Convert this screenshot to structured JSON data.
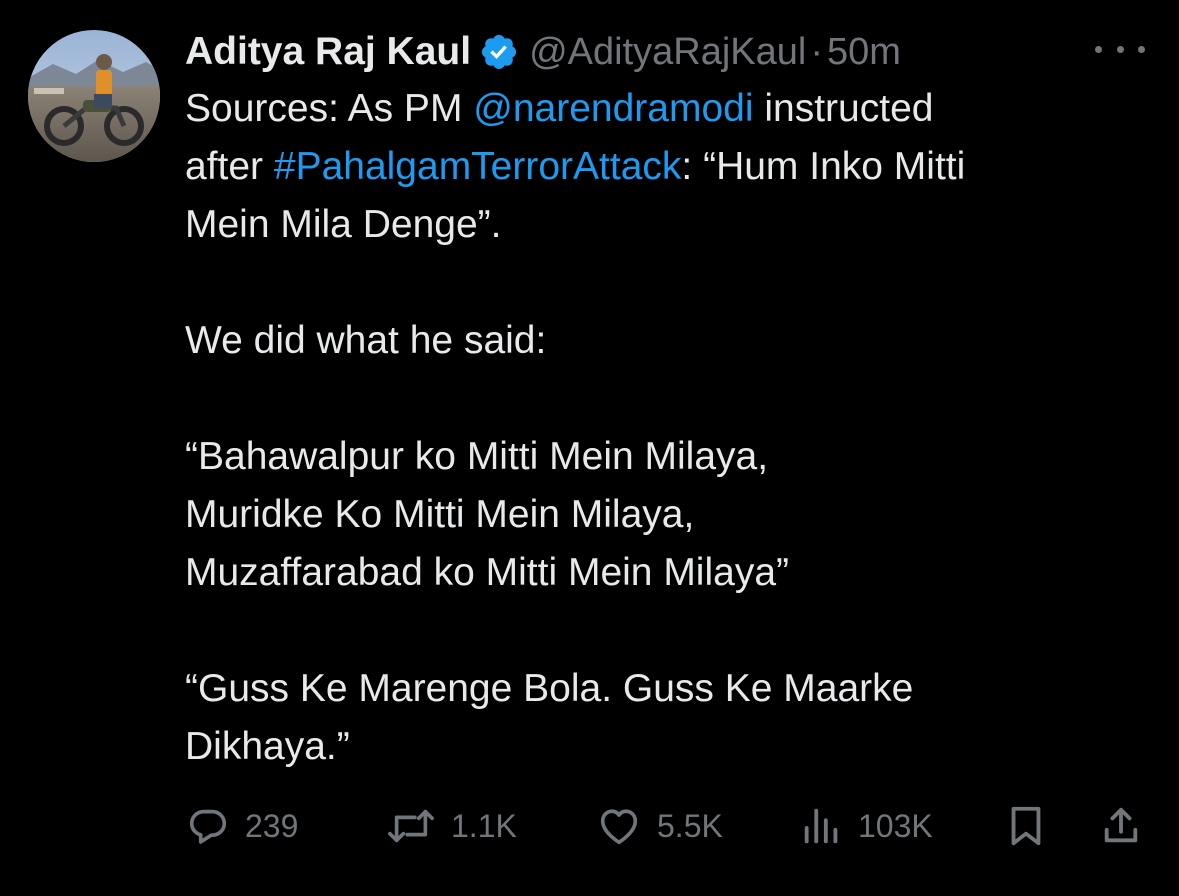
{
  "author": {
    "display_name": "Aditya Raj Kaul",
    "handle": "@AdityaRajKaul",
    "separator": "·",
    "time": "50m",
    "verified_icon": "verified-badge-icon",
    "avatar_icon": "avatar-image"
  },
  "tweet": {
    "line1_prefix": "Sources: As PM ",
    "mention": "@narendramodi",
    "line1_suffix": " instructed",
    "line2_prefix": "after ",
    "hashtag": "#PahalgamTerrorAttack",
    "line2_suffix": ": “Hum Inko Mitti",
    "line3": "Mein Mila Denge”.",
    "line4": "We did what he said:",
    "line5": "“Bahawalpur ko Mitti Mein Milaya,",
    "line6": "Muridke Ko Mitti Mein Milaya,",
    "line7": "Muzaffarabad ko Mitti Mein Milaya”",
    "line8": "“Guss Ke Marenge Bola. Guss Ke Maarke",
    "line9": "Dikhaya.”"
  },
  "actions": {
    "replies": "239",
    "reposts": "1.1K",
    "likes": "5.5K",
    "views": "103K"
  },
  "colors": {
    "background": "#000000",
    "text": "#e7e9ea",
    "muted": "#71767b",
    "link": "#1d9bf0"
  }
}
